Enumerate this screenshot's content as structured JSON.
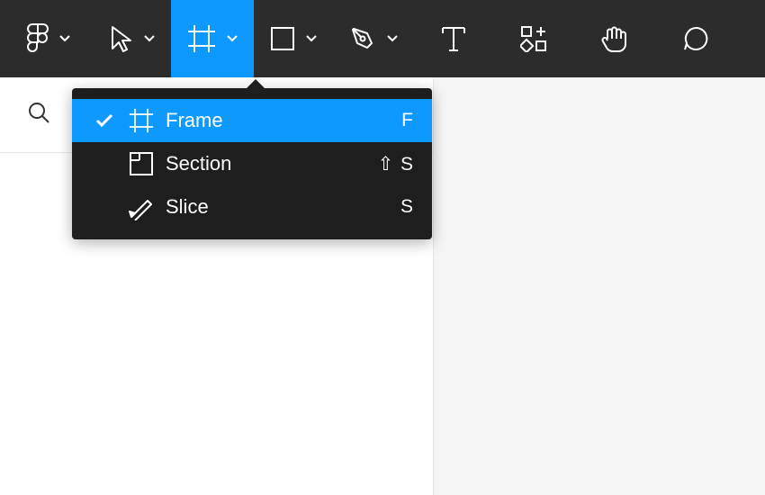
{
  "toolbar": {
    "items": [
      {
        "name": "main-menu",
        "icon": "figma-logo",
        "hasChevron": true
      },
      {
        "name": "move-tool",
        "icon": "move",
        "hasChevron": true
      },
      {
        "name": "frame-tool",
        "icon": "frame",
        "hasChevron": true,
        "active": true
      },
      {
        "name": "shape-tool",
        "icon": "rectangle",
        "hasChevron": true
      },
      {
        "name": "pen-tool",
        "icon": "pen",
        "hasChevron": true
      },
      {
        "name": "text-tool",
        "icon": "text",
        "hasChevron": false
      },
      {
        "name": "resources-tool",
        "icon": "resources",
        "hasChevron": false
      },
      {
        "name": "hand-tool",
        "icon": "hand",
        "hasChevron": false
      },
      {
        "name": "comment-tool",
        "icon": "comment",
        "hasChevron": false
      }
    ]
  },
  "dropdown": {
    "items": [
      {
        "label": "Frame",
        "shortcut": "F",
        "icon": "frame",
        "selected": true
      },
      {
        "label": "Section",
        "shortcut": "⇧ S",
        "icon": "section",
        "selected": false
      },
      {
        "label": "Slice",
        "shortcut": "S",
        "icon": "slice",
        "selected": false
      }
    ]
  },
  "colors": {
    "accent": "#0d99ff",
    "toolbar": "#2c2c2c",
    "dropdown": "#1e1e1e"
  }
}
